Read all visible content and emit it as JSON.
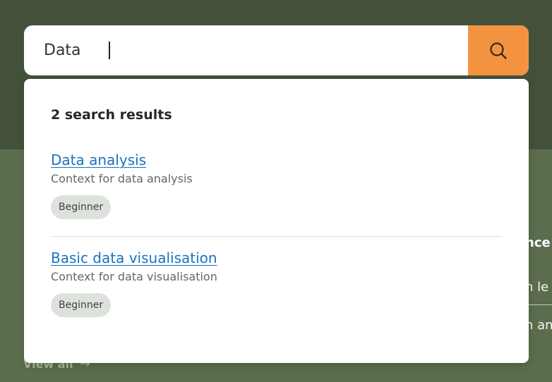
{
  "search": {
    "query": "Data",
    "button_icon": "search-icon"
  },
  "results": {
    "count_label": "2 search results",
    "items": [
      {
        "title": "Data analysis",
        "context": "Context for data analysis",
        "level": "Beginner"
      },
      {
        "title": "Basic data visualisation",
        "context": "Context for data visualisation",
        "level": "Beginner"
      }
    ]
  },
  "background": {
    "heading_fragment": "nce",
    "line_1_fragment": "n le",
    "line_2_fragment": "n an",
    "view_all_label": "View all",
    "view_all_icon": "arrow-right-icon"
  },
  "colors": {
    "hero_green": "#43513b",
    "section_green": "#5b6d4c",
    "search_button_orange": "#f4933f",
    "link_blue": "#1a71c2",
    "badge_bg": "#dde3dc"
  }
}
